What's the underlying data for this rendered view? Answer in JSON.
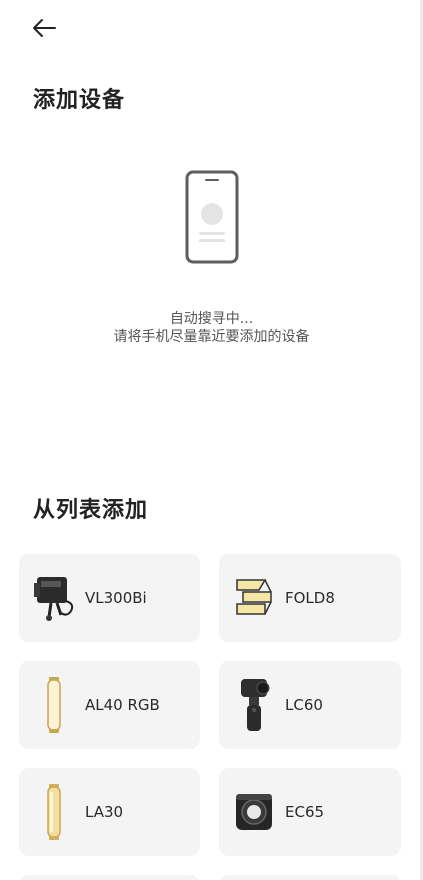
{
  "header": {
    "title": "添加设备"
  },
  "scan": {
    "status": "自动搜寻中...",
    "hint": "请将手机尽量靠近要添加的设备"
  },
  "list_section": {
    "title": "从列表添加"
  },
  "devices": [
    {
      "name": "VL300Bi",
      "icon": "vl300bi-light-icon"
    },
    {
      "name": "FOLD8",
      "icon": "fold8-panel-icon"
    },
    {
      "name": "AL40 RGB",
      "icon": "al40-tube-icon"
    },
    {
      "name": "LC60",
      "icon": "lc60-light-icon"
    },
    {
      "name": "LA30",
      "icon": "la30-tube-icon"
    },
    {
      "name": "EC65",
      "icon": "ec65-light-icon"
    }
  ],
  "colors": {
    "card_bg": "#f4f4f4",
    "text": "#222222",
    "subtext": "#555555"
  }
}
